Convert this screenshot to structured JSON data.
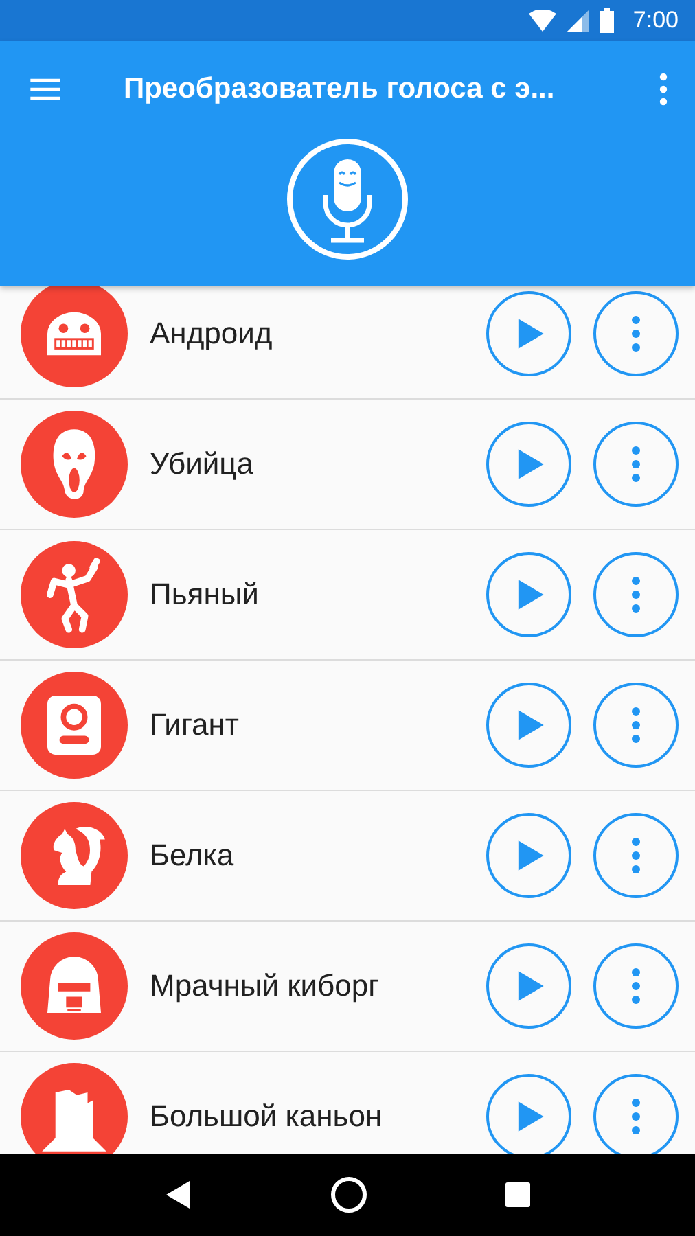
{
  "status_bar": {
    "time": "7:00"
  },
  "app_bar": {
    "title": "Преобразователь голоса с э..."
  },
  "voices": [
    {
      "name": "Андроид",
      "kind": "robot"
    },
    {
      "name": "Убийца",
      "kind": "mask"
    },
    {
      "name": "Пьяный",
      "kind": "dancer"
    },
    {
      "name": "Гигант",
      "kind": "portrait"
    },
    {
      "name": "Белка",
      "kind": "squirrel"
    },
    {
      "name": "Мрачный киборг",
      "kind": "helmet"
    },
    {
      "name": "Большой каньон",
      "kind": "butte"
    }
  ]
}
